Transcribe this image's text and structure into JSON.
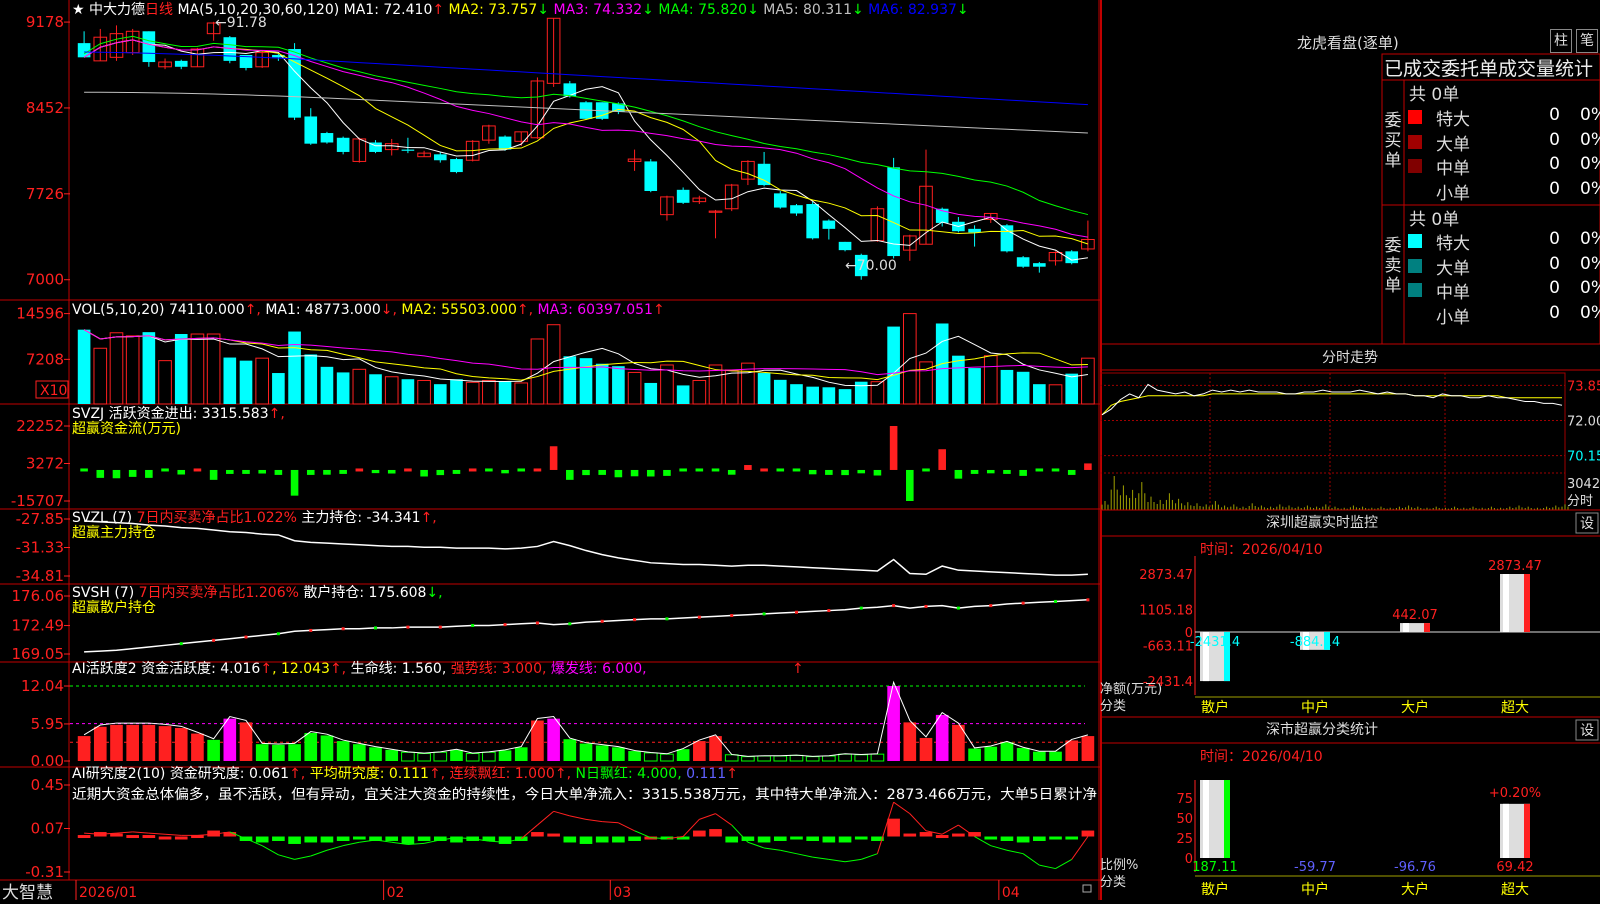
{
  "colors": {
    "up": "#ff2020",
    "down": "#00ffff",
    "bg": "#000000",
    "grid": "#a00000",
    "border": "#c00000",
    "ma1": "#ffffff",
    "ma2": "#ffff00",
    "ma3": "#ff00ff",
    "ma4": "#00ff00",
    "ma5": "#c0c0c0",
    "ma6": "#0000ff",
    "green": "#00ff00",
    "magenta": "#ff00ff",
    "yellow": "#ffff00"
  },
  "price": {
    "axis": [
      "9178",
      "8452",
      "7726",
      "7000"
    ],
    "axis_values": [
      9178,
      8452,
      7726,
      7000
    ],
    "stock_name": "中大力德",
    "period": "日线",
    "ma_params": "MA(5,10,20,30,60,120)",
    "ma": [
      {
        "name": "MA1:",
        "value": "72.410",
        "arrow": "↑"
      },
      {
        "name": "MA2:",
        "value": "73.757",
        "arrow": "↓"
      },
      {
        "name": "MA3:",
        "value": "74.332",
        "arrow": "↓"
      },
      {
        "name": "MA4:",
        "value": "75.820",
        "arrow": "↓"
      },
      {
        "name": "MA5:",
        "value": "80.311",
        "arrow": "↓"
      },
      {
        "name": "MA6:",
        "value": "82.937",
        "arrow": "↓"
      }
    ],
    "high_mark": "91.78",
    "low_mark": "70.00",
    "candles": [
      [
        90.0,
        88.8,
        89.0,
        91.0
      ],
      [
        88.5,
        90.5,
        88.5,
        91.2
      ],
      [
        88.8,
        90.8,
        88.5,
        91.5
      ],
      [
        89.2,
        91.0,
        89.0,
        91.2
      ],
      [
        91.0,
        88.4,
        88.0,
        91.0
      ],
      [
        88.0,
        88.4,
        87.8,
        88.7
      ],
      [
        88.5,
        88.0,
        87.8,
        88.6
      ],
      [
        88.0,
        89.5,
        88.0,
        89.6
      ],
      [
        90.8,
        91.7,
        90.2,
        91.8
      ],
      [
        90.5,
        88.5,
        88.3,
        90.6
      ],
      [
        89.0,
        87.9,
        87.7,
        89.0
      ],
      [
        88.0,
        89.2,
        87.9,
        89.3
      ],
      [
        89.0,
        88.8,
        88.5,
        89.1
      ],
      [
        89.5,
        83.7,
        83.5,
        90.0
      ],
      [
        83.8,
        81.5,
        81.4,
        84.5
      ],
      [
        82.4,
        81.6,
        81.5,
        82.5
      ],
      [
        82.0,
        80.8,
        80.6,
        82.1
      ],
      [
        80.0,
        81.9,
        79.9,
        82.0
      ],
      [
        81.6,
        80.8,
        80.7,
        81.8
      ],
      [
        81.0,
        81.5,
        80.5,
        81.9
      ],
      [
        81.0,
        80.9,
        80.7,
        82.0
      ],
      [
        80.4,
        80.7,
        80.4,
        80.9
      ],
      [
        80.6,
        80.1,
        79.9,
        80.8
      ],
      [
        80.2,
        79.1,
        79.0,
        80.3
      ],
      [
        80.1,
        81.7,
        80.0,
        81.8
      ],
      [
        81.8,
        83.0,
        81.5,
        83.1
      ],
      [
        82.1,
        81.0,
        80.9,
        82.2
      ],
      [
        81.7,
        82.5,
        81.3,
        82.5
      ],
      [
        82.0,
        86.8,
        81.9,
        87.1
      ],
      [
        86.6,
        92.1,
        86.3,
        92.1
      ],
      [
        86.6,
        85.5,
        85.4,
        86.8
      ],
      [
        85.0,
        83.6,
        83.5,
        85.1
      ],
      [
        85.0,
        83.6,
        83.5,
        85.0
      ],
      [
        84.9,
        84.2,
        84.0,
        85.0
      ],
      [
        80.0,
        80.2,
        79.2,
        81.0
      ],
      [
        80.0,
        77.5,
        77.4,
        80.2
      ],
      [
        75.5,
        77.0,
        75.0,
        77.1
      ],
      [
        77.6,
        76.5,
        76.4,
        77.8
      ],
      [
        76.6,
        76.9,
        76.4,
        77.1
      ],
      [
        75.7,
        75.8,
        73.5,
        75.9
      ],
      [
        76.0,
        78.0,
        75.8,
        78.1
      ],
      [
        78.5,
        80.0,
        78.0,
        80.1
      ],
      [
        79.8,
        78.0,
        77.9,
        80.8
      ],
      [
        77.3,
        76.1,
        76.0,
        77.5
      ],
      [
        76.3,
        75.6,
        75.4,
        76.4
      ],
      [
        76.4,
        73.5,
        73.4,
        76.6
      ],
      [
        75.0,
        74.3,
        73.4,
        75.1
      ],
      [
        73.2,
        72.5,
        72.4,
        73.2
      ],
      [
        72.1,
        70.3,
        70.0,
        72.2
      ],
      [
        73.3,
        76.0,
        73.2,
        76.2
      ],
      [
        79.5,
        72.0,
        71.8,
        80.3
      ],
      [
        72.5,
        73.7,
        71.6,
        73.8
      ],
      [
        73.0,
        77.9,
        73.0,
        81.0
      ],
      [
        76.0,
        74.8,
        74.5,
        76.1
      ],
      [
        74.9,
        74.1,
        74.0,
        75.3
      ],
      [
        74.3,
        74.0,
        72.8,
        74.6
      ],
      [
        75.1,
        75.6,
        74.8,
        75.6
      ],
      [
        74.6,
        72.4,
        72.3,
        74.7
      ],
      [
        71.9,
        71.1,
        71.0,
        72.0
      ],
      [
        71.4,
        71.1,
        70.6,
        71.5
      ],
      [
        71.6,
        72.3,
        71.2,
        72.4
      ],
      [
        72.4,
        71.4,
        71.3,
        72.5
      ],
      [
        72.6,
        73.4,
        72.4,
        75.0
      ]
    ],
    "y_range": [
      69.3,
      92.8
    ]
  },
  "volume": {
    "axis": [
      "14596",
      "7208"
    ],
    "axis_values": [
      14596,
      7208
    ],
    "unit": "X10",
    "label": "VOL(5,10,20)",
    "value": "74110.000",
    "ma": [
      {
        "name": "MA1:",
        "value": "48773.000",
        "arrow": "↑"
      },
      {
        "name": "MA2:",
        "value": "55503.000",
        "arrow": "↓"
      },
      {
        "name": "MA3:",
        "value": "60397.051",
        "arrow": "↑"
      }
    ],
    "bars": [
      12000,
      9000,
      11500,
      11000,
      11600,
      7000,
      11300,
      11300,
      11300,
      7500,
      7000,
      7400,
      5000,
      11700,
      8000,
      6000,
      5100,
      5600,
      4800,
      4400,
      4000,
      3800,
      3200,
      4000,
      3500,
      3800,
      3700,
      3400,
      10500,
      12800,
      7700,
      7400,
      6500,
      6100,
      5100,
      3400,
      6300,
      3000,
      3800,
      6300,
      5500,
      6600,
      5000,
      3900,
      3200,
      2800,
      2700,
      2400,
      3600,
      3600,
      12500,
      14596,
      6800,
      13000,
      7800,
      5800,
      7800,
      5500,
      5200,
      3200,
      3100,
      4900,
      7400
    ]
  },
  "svzj": {
    "axis": [
      "22252",
      "3272",
      "-15707"
    ],
    "axis_values": [
      22252,
      3272,
      -15707
    ],
    "label": "SVZJ",
    "title": "活跃资金进出:",
    "value": "3315.583",
    "arrow": "↑",
    "subtitle": "超赢资金流(万元)",
    "bars": [
      -300,
      -4000,
      -4200,
      -3500,
      -4000,
      -1000,
      -2300,
      500,
      -5000,
      -2000,
      -2000,
      -1800,
      -2500,
      -13000,
      -2500,
      -2400,
      -2000,
      500,
      -1600,
      -1800,
      300,
      -3300,
      -2600,
      -2000,
      700,
      -1000,
      -1700,
      -700,
      1000,
      12000,
      -5000,
      -2600,
      -2500,
      -3700,
      -3200,
      -3300,
      -3000,
      -1000,
      -300,
      -1500,
      -2400,
      2500,
      1000,
      -300,
      -1400,
      -2200,
      -2500,
      -2600,
      -1700,
      -2800,
      22252,
      -15707,
      -1000,
      10500,
      -4400,
      -2000,
      -1700,
      -2000,
      -3000,
      -1000,
      -100,
      -2500,
      3315
    ]
  },
  "svzl": {
    "axis": [
      "-27.85",
      "-31.33",
      "-34.81"
    ],
    "axis_values": [
      -27.85,
      -31.33,
      -34.81
    ],
    "label": "SVZL",
    "param": "(7)",
    "ratio_text": "7日内买卖净占比1.022%",
    "hold_label": "主力持仓:",
    "hold_value": "-34.341",
    "arrow": "↑",
    "subtitle": "超赢主力持仓",
    "values": [
      -28.1,
      -28.2,
      -28.3,
      -28.4,
      -28.6,
      -28.7,
      -28.9,
      -29.0,
      -29.2,
      -29.4,
      -29.5,
      -29.7,
      -29.8,
      -30.5,
      -30.7,
      -30.8,
      -30.9,
      -31.0,
      -31.1,
      -31.2,
      -31.2,
      -31.3,
      -31.3,
      -31.4,
      -31.4,
      -31.4,
      -31.5,
      -31.4,
      -31.2,
      -30.6,
      -31.1,
      -31.7,
      -32.2,
      -32.6,
      -32.9,
      -33.2,
      -33.3,
      -33.4,
      -33.4,
      -33.5,
      -33.6,
      -33.5,
      -33.5,
      -33.6,
      -33.7,
      -33.8,
      -33.9,
      -34.0,
      -34.1,
      -34.2,
      -32.8,
      -34.5,
      -34.6,
      -33.6,
      -34.1,
      -34.2,
      -34.3,
      -34.4,
      -34.5,
      -34.6,
      -34.7,
      -34.7,
      -34.6
    ]
  },
  "svsh": {
    "axis": [
      "176.06",
      "172.49",
      "169.05"
    ],
    "axis_values": [
      176.06,
      172.49,
      169.05
    ],
    "label": "SVSH",
    "param": "(7)",
    "ratio_text": "7日内买卖净占比1.206%",
    "hold_label": "散户持仓:",
    "hold_value": "175.608",
    "arrow": "↓",
    "subtitle": "超赢散户持仓",
    "values": [
      169.3,
      169.4,
      169.5,
      169.7,
      169.9,
      170.1,
      170.3,
      170.5,
      170.7,
      170.9,
      171.1,
      171.3,
      171.5,
      171.8,
      171.9,
      172.0,
      172.1,
      172.1,
      172.2,
      172.2,
      172.3,
      172.3,
      172.3,
      172.4,
      172.5,
      172.5,
      172.6,
      172.7,
      172.8,
      172.6,
      172.7,
      172.9,
      173.0,
      173.1,
      173.2,
      173.3,
      173.3,
      173.4,
      173.5,
      173.6,
      173.7,
      173.8,
      173.9,
      174.0,
      174.1,
      174.2,
      174.3,
      174.4,
      174.6,
      174.7,
      174.9,
      174.6,
      174.8,
      174.9,
      174.6,
      174.8,
      174.9,
      175.1,
      175.2,
      175.3,
      175.4,
      175.5,
      175.6
    ]
  },
  "ai1": {
    "axis": [
      "12.04",
      "5.95",
      "0.00"
    ],
    "axis_values": [
      12.04,
      5.95,
      0.0
    ],
    "label": "AI活跃度2",
    "text1": "资金活跃度:",
    "v1": "4.016",
    "v2": "12.043",
    "text3": "生命线:",
    "v3": "1.560",
    "text4": "强势线:",
    "v4": "3.000",
    "text5": "爆发线:",
    "v5": "6.000",
    "bars": [
      4,
      5.5,
      5.8,
      5.8,
      5.8,
      5.6,
      5.3,
      4.4,
      3.4,
      6.8,
      6.2,
      2.7,
      2.6,
      2.7,
      4.5,
      4.1,
      3.2,
      2.7,
      2.2,
      1.8,
      1.4,
      1.2,
      1.4,
      1.8,
      1.2,
      1.4,
      1.7,
      2.2,
      6.5,
      6.8,
      3.5,
      2.8,
      2.5,
      2.2,
      1.6,
      1.3,
      1.1,
      1.9,
      3.2,
      4.0,
      1.0,
      0.7,
      0.8,
      0.8,
      0.9,
      0.7,
      0.8,
      1.1,
      1.0,
      1.1,
      12.04,
      6.2,
      3.7,
      7.4,
      5.8,
      2.0,
      2.3,
      3.0,
      2.1,
      1.5,
      1.5,
      3.3,
      4.0
    ],
    "colors": [
      "r",
      "r",
      "r",
      "r",
      "r",
      "r",
      "r",
      "r",
      "g",
      "m",
      "r",
      "g",
      "g",
      "g",
      "g",
      "g",
      "g",
      "g",
      "g",
      "g",
      "g",
      "g",
      "g",
      "g",
      "g",
      "g",
      "g",
      "g",
      "r",
      "m",
      "g",
      "g",
      "g",
      "g",
      "g",
      "g",
      "g",
      "g",
      "r",
      "r",
      "g",
      "g",
      "g",
      "g",
      "g",
      "g",
      "g",
      "g",
      "g",
      "g",
      "m",
      "r",
      "r",
      "m",
      "r",
      "g",
      "g",
      "g",
      "g",
      "g",
      "g",
      "r",
      "r"
    ]
  },
  "ai2": {
    "axis": [
      "0.45",
      "0.07",
      "-0.31"
    ],
    "axis_values": [
      0.45,
      0.07,
      -0.31
    ],
    "label": "AI研究度2(10)",
    "text1": "资金研究度:",
    "v1": "0.061",
    "text2": "平均研究度:",
    "v2": "0.111",
    "text3": "连续飘红:",
    "v3": "1.000",
    "text4": "N日飘红:",
    "v4": "4.000",
    "v5": "0.111",
    "commentary": "近期大资金总体偏多，虽不活跃，但有异动，宜关注大资金的持续性，今日大单净流入：3315.538万元，其中特大单净流入：2873.466万元，大单5日累计净",
    "bars": [
      0.01,
      0.03,
      0.02,
      0.01,
      0.01,
      0.0,
      0.0,
      0.01,
      0.04,
      0.03,
      -0.03,
      -0.04,
      -0.03,
      -0.05,
      -0.04,
      -0.04,
      -0.03,
      -0.02,
      -0.03,
      -0.03,
      -0.05,
      -0.03,
      -0.03,
      -0.04,
      -0.03,
      -0.03,
      -0.05,
      -0.03,
      0.03,
      0.02,
      -0.04,
      -0.05,
      -0.04,
      -0.04,
      -0.03,
      0.0,
      -0.02,
      -0.01,
      0.04,
      0.05,
      -0.04,
      -0.03,
      -0.04,
      -0.03,
      -0.02,
      -0.03,
      -0.04,
      -0.04,
      -0.01,
      -0.03,
      0.12,
      0.02,
      0.03,
      0.01,
      0.02,
      0.03,
      -0.02,
      -0.03,
      -0.04,
      -0.03,
      -0.02,
      -0.01,
      0.04
    ],
    "line": [
      0.03,
      0.02,
      0.03,
      0.04,
      0.03,
      0.02,
      0.01,
      0.01,
      0.02,
      0.04,
      -0.02,
      -0.08,
      -0.16,
      -0.2,
      -0.17,
      -0.12,
      -0.08,
      -0.05,
      -0.03,
      -0.05,
      -0.07,
      -0.06,
      -0.03,
      -0.01,
      -0.02,
      -0.04,
      -0.05,
      -0.02,
      0.1,
      0.22,
      0.18,
      0.15,
      0.13,
      0.12,
      0.05,
      -0.01,
      -0.02,
      0.0,
      0.15,
      0.2,
      0.1,
      -0.05,
      -0.1,
      -0.12,
      -0.15,
      -0.18,
      -0.2,
      -0.22,
      -0.2,
      -0.15,
      0.3,
      0.2,
      0.05,
      0.02,
      0.1,
      0.0,
      -0.08,
      -0.12,
      -0.15,
      -0.25,
      -0.28,
      -0.2,
      0.0
    ]
  },
  "xaxis": {
    "labels": [
      {
        "text": "2026/01",
        "i": 0
      },
      {
        "text": "02",
        "i": 19
      },
      {
        "text": "03",
        "i": 33
      },
      {
        "text": "04",
        "i": 57
      }
    ]
  },
  "brand": "大智慧",
  "orderbook": {
    "title": "龙虎看盘(逐单)",
    "btn1": "柱",
    "btn2": "笔",
    "header": "已成交委托单成交量统计",
    "buy_label": "委买单",
    "sell_label": "委卖单",
    "buy_total": "共 0单",
    "sell_total": "共 0单",
    "buy_rows": [
      {
        "label": "特大",
        "qty": "0",
        "pct": "0%",
        "color": "#ff0000"
      },
      {
        "label": "大单",
        "qty": "0",
        "pct": "0%",
        "color": "#a00000"
      },
      {
        "label": "中单",
        "qty": "0",
        "pct": "0%",
        "color": "#800000"
      },
      {
        "label": "小单",
        "qty": "0",
        "pct": "0%",
        "color": "#000000"
      }
    ],
    "sell_rows": [
      {
        "label": "特大",
        "qty": "0",
        "pct": "0%",
        "color": "#00ffff"
      },
      {
        "label": "大单",
        "qty": "0",
        "pct": "0%",
        "color": "#008080"
      },
      {
        "label": "中单",
        "qty": "0",
        "pct": "0%",
        "color": "#008080"
      },
      {
        "label": "小单",
        "qty": "0",
        "pct": "0%",
        "color": "#000000"
      }
    ]
  },
  "intraday": {
    "title": "分时走势",
    "labels": [
      "73.85",
      "72.00",
      "70.15",
      "3042",
      "分时"
    ],
    "label_values": [
      73.85,
      72.0,
      70.15
    ],
    "price_line": [
      72.3,
      72.6,
      73.1,
      73.4,
      73.2,
      73.9,
      73.6,
      73.5,
      73.4,
      73.5,
      73.3,
      73.4,
      73.6,
      73.5,
      73.6,
      73.5,
      73.6,
      73.5,
      73.5,
      73.5,
      73.4,
      73.4,
      73.5,
      73.5,
      73.6,
      73.5,
      73.5,
      73.5,
      73.6,
      73.5,
      73.4,
      73.5,
      73.4,
      73.4,
      73.3,
      73.3,
      73.2,
      73.4,
      73.3,
      73.3,
      73.2,
      73.2,
      73.3,
      73.2,
      73.2,
      73.1,
      73.0,
      73.0,
      72.9,
      72.9,
      72.8
    ],
    "avg_line": [
      72.3,
      72.8,
      73.0,
      73.1,
      73.2,
      73.3,
      73.3,
      73.3,
      73.3,
      73.3,
      73.3,
      73.3,
      73.4,
      73.4,
      73.4,
      73.4,
      73.4,
      73.4,
      73.4,
      73.4,
      73.4,
      73.4,
      73.4,
      73.4,
      73.4,
      73.4,
      73.4,
      73.4,
      73.4,
      73.4,
      73.4,
      73.4,
      73.4,
      73.4,
      73.3,
      73.3,
      73.3,
      73.3,
      73.3,
      73.3,
      73.3,
      73.3,
      73.3,
      73.3,
      73.2,
      73.2,
      73.2,
      73.2,
      73.2,
      73.2,
      73.2
    ],
    "vol_bars": [
      800,
      3042,
      2200,
      1800,
      2500,
      1200,
      900,
      1500,
      1000,
      700,
      600,
      500,
      800,
      400,
      500,
      300,
      600,
      400,
      300,
      500,
      400,
      300,
      400,
      300,
      500,
      300,
      200,
      400,
      300,
      200,
      300,
      200,
      300,
      400,
      300,
      200,
      300,
      200,
      300,
      200,
      300,
      200,
      300,
      200,
      300,
      400,
      300,
      200,
      300,
      400,
      500
    ]
  },
  "sz_monitor": {
    "title": "深圳超赢实时监控",
    "btn": "设",
    "time_label": "时间：",
    "time": "2026/04/10",
    "axis": [
      "2873.47",
      "1105.18",
      "0",
      "-663.11",
      "-2431.4"
    ],
    "axis_values": [
      2873.47,
      1105.18,
      0,
      -663.11,
      -2431.4
    ],
    "net_label": "净额(万元)",
    "cat_label": "分类",
    "cats": [
      "散户",
      "中户",
      "大户",
      "超大"
    ],
    "values": [
      "-2431.4",
      "-884.14",
      "442.07",
      "2873.47"
    ],
    "nums": [
      -2431.4,
      -884.14,
      442.07,
      2873.47
    ]
  },
  "sz_class": {
    "title": "深市超赢分类统计",
    "btn": "设",
    "time_label": "时间：",
    "time": "2026/04/10",
    "axis": [
      "75",
      "50",
      "25",
      "0"
    ],
    "axis_values": [
      75,
      50,
      25,
      0
    ],
    "pct_label": "比例%",
    "cat_label": "分类",
    "cats": [
      "散户",
      "中户",
      "大户",
      "超大"
    ],
    "values": [
      "187.11",
      "-59.77",
      "-96.76",
      "69.42"
    ],
    "bar_pct": [
      100,
      0,
      0,
      69.42
    ],
    "top_label": "+0.20%"
  }
}
